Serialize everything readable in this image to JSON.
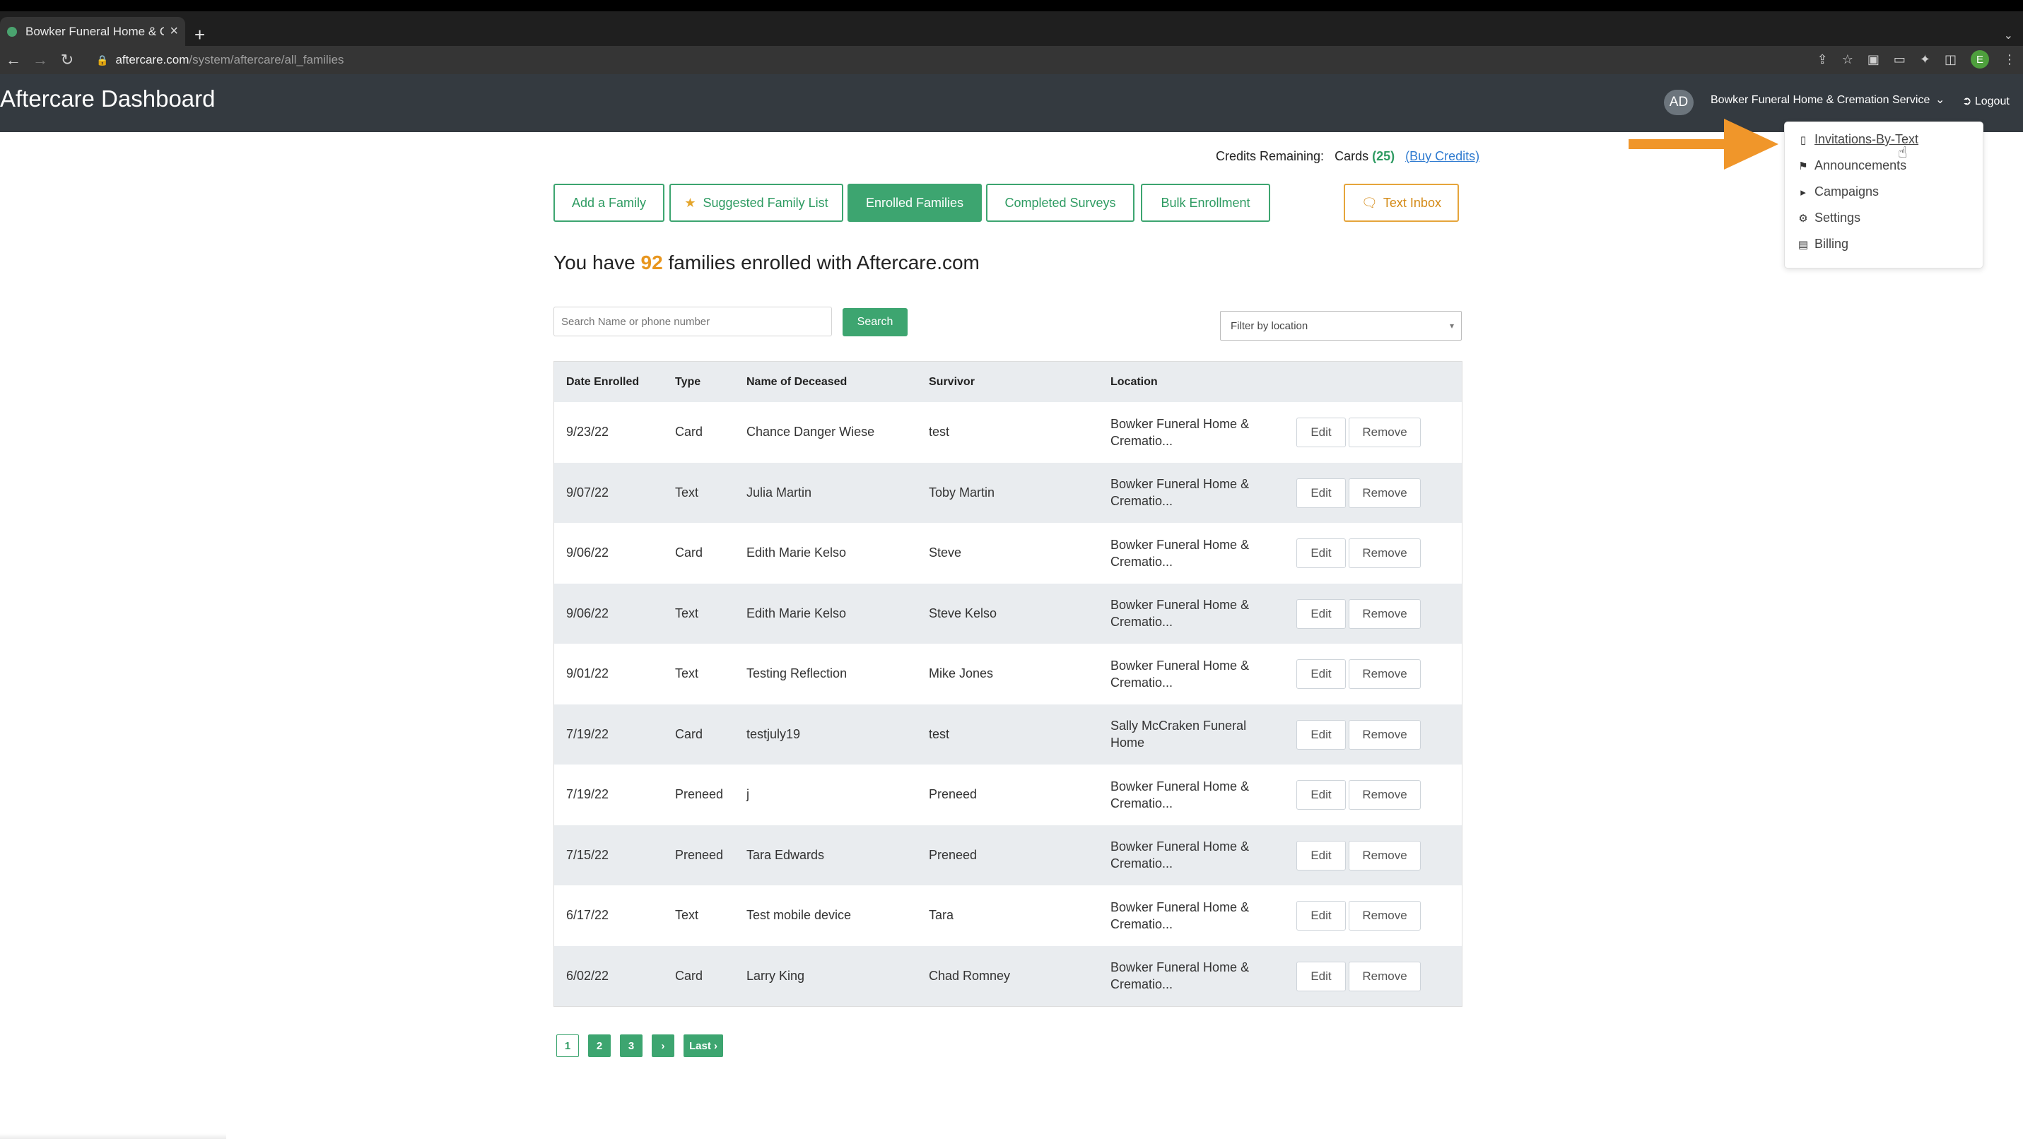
{
  "browser": {
    "tab_title": "Bowker Funeral Home & Cremation Service",
    "tab_close": "×",
    "new_tab": "+",
    "url_host": "aftercare.com",
    "url_path": "/system/aftercare/all_families",
    "profile_initial": "E"
  },
  "header": {
    "app_title": "Aftercare Dashboard",
    "avatar_initials": "AD",
    "org_name": "Bowker Funeral Home & Cremation Service",
    "logout_label": "Logout"
  },
  "credits": {
    "label": "Credits Remaining:",
    "cards_label": "Cards",
    "cards_count": "(25)",
    "buy_label": "(Buy Credits)"
  },
  "nav_tabs": {
    "add_family": "Add a Family",
    "suggested": "Suggested Family List",
    "enrolled": "Enrolled Families",
    "surveys": "Completed Surveys",
    "bulk": "Bulk Enrollment",
    "text_inbox": "Text Inbox"
  },
  "summary": {
    "prefix": "You have",
    "count": "92",
    "suffix": "families enrolled with Aftercare.com"
  },
  "search": {
    "placeholder": "Search Name or phone number",
    "button_label": "Search",
    "filter_label": "Filter by location"
  },
  "table": {
    "headers": {
      "date": "Date Enrolled",
      "type": "Type",
      "deceased": "Name of Deceased",
      "survivor": "Survivor",
      "location": "Location"
    },
    "edit_label": "Edit",
    "remove_label": "Remove",
    "rows": [
      {
        "date": "9/23/22",
        "type": "Card",
        "deceased": "Chance Danger Wiese",
        "survivor": "test",
        "loc1": "Bowker Funeral Home &",
        "loc2": "Crematio..."
      },
      {
        "date": "9/07/22",
        "type": "Text",
        "deceased": "Julia Martin",
        "survivor": "Toby Martin",
        "loc1": "Bowker Funeral Home &",
        "loc2": "Crematio..."
      },
      {
        "date": "9/06/22",
        "type": "Card",
        "deceased": "Edith Marie Kelso",
        "survivor": "Steve",
        "loc1": "Bowker Funeral Home &",
        "loc2": "Crematio..."
      },
      {
        "date": "9/06/22",
        "type": "Text",
        "deceased": "Edith Marie Kelso",
        "survivor": "Steve Kelso",
        "loc1": "Bowker Funeral Home &",
        "loc2": "Crematio..."
      },
      {
        "date": "9/01/22",
        "type": "Text",
        "deceased": "Testing Reflection",
        "survivor": "Mike Jones",
        "loc1": "Bowker Funeral Home &",
        "loc2": "Crematio..."
      },
      {
        "date": "7/19/22",
        "type": "Card",
        "deceased": "testjuly19",
        "survivor": "test",
        "loc1": "Sally McCraken Funeral",
        "loc2": "Home"
      },
      {
        "date": "7/19/22",
        "type": "Preneed",
        "deceased": "j",
        "survivor": "Preneed",
        "loc1": "Bowker Funeral Home &",
        "loc2": "Crematio..."
      },
      {
        "date": "7/15/22",
        "type": "Preneed",
        "deceased": "Tara Edwards",
        "survivor": "Preneed",
        "loc1": "Bowker Funeral Home &",
        "loc2": "Crematio..."
      },
      {
        "date": "6/17/22",
        "type": "Text",
        "deceased": "Test mobile device",
        "survivor": "Tara",
        "loc1": "Bowker Funeral Home &",
        "loc2": "Crematio..."
      },
      {
        "date": "6/02/22",
        "type": "Card",
        "deceased": "Larry King",
        "survivor": "Chad Romney",
        "loc1": "Bowker Funeral Home &",
        "loc2": "Crematio..."
      }
    ]
  },
  "pagination": {
    "pages": [
      "1",
      "2",
      "3"
    ],
    "next": "›",
    "last": "Last ›"
  },
  "dropdown_menu": {
    "items": [
      {
        "label": "Invitations-By-Text",
        "icon": "mobile-icon"
      },
      {
        "label": "Announcements",
        "icon": "bookmark-icon"
      },
      {
        "label": "Campaigns",
        "icon": "megaphone-icon"
      },
      {
        "label": "Settings",
        "icon": "gear-icon"
      },
      {
        "label": "Billing",
        "icon": "credit-card-icon"
      }
    ]
  },
  "colors": {
    "brand_green": "#3da570",
    "accent_orange": "#e8961e",
    "header_bg": "#343a40",
    "annotation_arrow": "#f0962a"
  }
}
